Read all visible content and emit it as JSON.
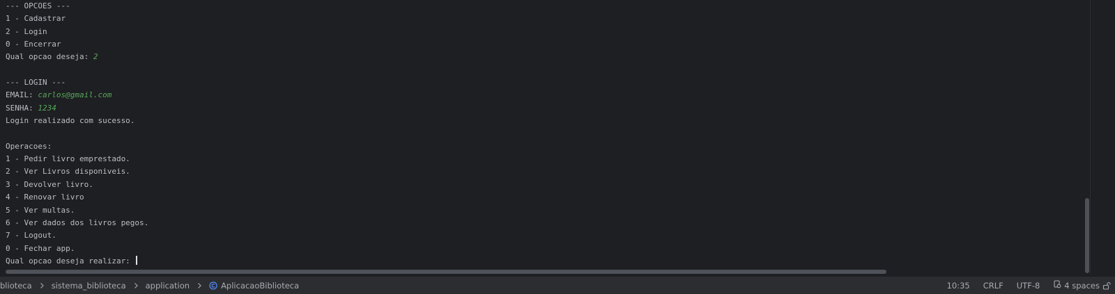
{
  "console": {
    "lines": [
      {
        "text": "--- OPCOES ---",
        "input": ""
      },
      {
        "text": "1 - Cadastrar",
        "input": ""
      },
      {
        "text": "2 - Login",
        "input": ""
      },
      {
        "text": "0 - Encerrar",
        "input": ""
      },
      {
        "text": "Qual opcao deseja: ",
        "input": "2"
      },
      {
        "text": "",
        "input": ""
      },
      {
        "text": "--- LOGIN ---",
        "input": ""
      },
      {
        "text": "EMAIL: ",
        "input": "carlos@gmail.com"
      },
      {
        "text": "SENHA: ",
        "input": "1234"
      },
      {
        "text": "Login realizado com sucesso.",
        "input": ""
      },
      {
        "text": "",
        "input": ""
      },
      {
        "text": "Operacoes:",
        "input": ""
      },
      {
        "text": "1 - Pedir livro emprestado.",
        "input": ""
      },
      {
        "text": "2 - Ver Livros disponiveis.",
        "input": ""
      },
      {
        "text": "3 - Devolver livro.",
        "input": ""
      },
      {
        "text": "4 - Renovar livro",
        "input": ""
      },
      {
        "text": "5 - Ver multas.",
        "input": ""
      },
      {
        "text": "6 - Ver dados dos livros pegos.",
        "input": ""
      },
      {
        "text": "7 - Logout.",
        "input": ""
      },
      {
        "text": "0 - Fechar app.",
        "input": ""
      },
      {
        "text": "Qual opcao deseja realizar: ",
        "input": "",
        "caret": true
      }
    ],
    "text_color": "#bcbec4",
    "input_color": "#57a85a"
  },
  "status_bar": {
    "breadcrumbs": [
      {
        "label": "blioteca"
      },
      {
        "label": "sistema_biblioteca"
      },
      {
        "label": "application"
      },
      {
        "label": "AplicacaoBiblioteca",
        "icon": "java-class-icon"
      }
    ],
    "position": "10:35",
    "line_separator": "CRLF",
    "encoding": "UTF-8",
    "indent": "4 spaces"
  }
}
